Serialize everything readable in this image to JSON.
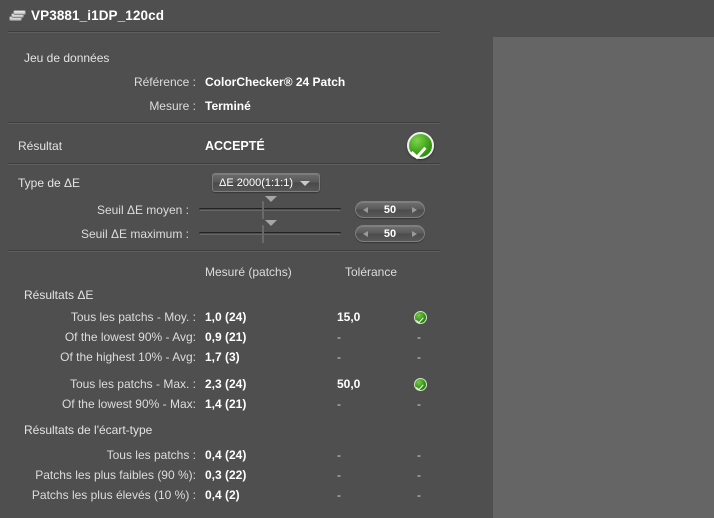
{
  "window": {
    "title": "VP3881_i1DP_120cd",
    "icon": "stacked-discs-icon"
  },
  "colors": {
    "background": "#4f4f4f",
    "panel": "#656565",
    "text": "#dcdcdc",
    "value_text": "#ffffff",
    "pass_green": "#3da017"
  },
  "dataset": {
    "section_label": "Jeu de données",
    "rows": [
      {
        "label": "Référence :",
        "value": "ColorChecker® 24 Patch"
      },
      {
        "label": "Mesure :",
        "value": "Terminé"
      }
    ]
  },
  "result": {
    "label": "Résultat",
    "value": "ACCEPTÉ",
    "status_icon": "green-check-circle-icon"
  },
  "settings": {
    "delta_e_type_label": "Type de ΔE",
    "delta_e_type_value": "ΔE 2000(1:1:1)",
    "dropdown_icon": "chevron-down-icon",
    "sliders": [
      {
        "label": "Seuil ΔE moyen :",
        "value": "50"
      },
      {
        "label": "Seuil ΔE maximum :",
        "value": "50"
      }
    ],
    "spinner_left_icon": "arrow-left-icon",
    "spinner_right_icon": "arrow-right-icon"
  },
  "table": {
    "headers": {
      "measured": "Mesuré (patchs)",
      "tolerance": "Tolérance"
    },
    "sections": [
      {
        "title": "Résultats ΔE",
        "rows": [
          {
            "label": "Tous les patchs - Moy. :",
            "measured": "1,0  (24)",
            "tolerance": "15,0",
            "status": "pass"
          },
          {
            "label": "Of the lowest 90% - Avg:",
            "measured": "0,9  (21)",
            "tolerance": "-",
            "status": "-"
          },
          {
            "label": "Of the highest 10% - Avg:",
            "measured": "1,7  (3)",
            "tolerance": "-",
            "status": "-"
          },
          {
            "label": "Tous les patchs - Max. :",
            "measured": "2,3   (24)",
            "tolerance": "50,0",
            "status": "pass",
            "gap": true
          },
          {
            "label": "Of the lowest 90% - Max:",
            "measured": "1,4  (21)",
            "tolerance": "-",
            "status": "-"
          }
        ]
      },
      {
        "title": "Résultats de l'écart-type",
        "rows": [
          {
            "label": "Tous les patchs :",
            "measured": "0,4  (24)",
            "tolerance": "-",
            "status": "-"
          },
          {
            "label": "Patchs les plus faibles (90 %):",
            "measured": "0,3  (22)",
            "tolerance": "-",
            "status": "-"
          },
          {
            "label": "Patchs les plus élevés (10 %) :",
            "measured": "0,4   (2)",
            "tolerance": "-",
            "status": "-"
          }
        ]
      }
    ]
  }
}
